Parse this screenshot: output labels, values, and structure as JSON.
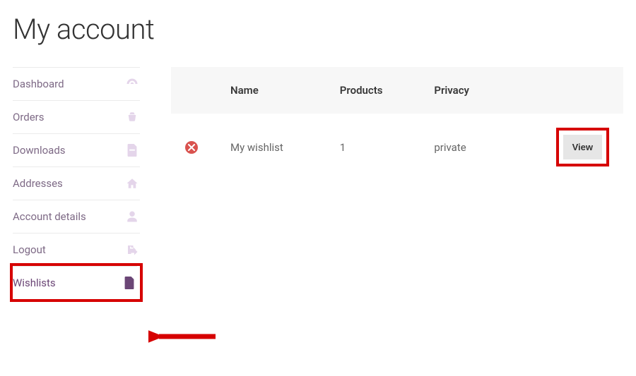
{
  "title": "My account",
  "sidebar": {
    "items": [
      {
        "label": "Dashboard",
        "icon": "dashboard-icon"
      },
      {
        "label": "Orders",
        "icon": "basket-icon"
      },
      {
        "label": "Downloads",
        "icon": "file-icon"
      },
      {
        "label": "Addresses",
        "icon": "home-icon"
      },
      {
        "label": "Account details",
        "icon": "user-icon"
      },
      {
        "label": "Logout",
        "icon": "logout-icon"
      },
      {
        "label": "Wishlists",
        "icon": "document-icon"
      }
    ]
  },
  "table": {
    "headers": {
      "name": "Name",
      "products": "Products",
      "privacy": "Privacy"
    },
    "rows": [
      {
        "name": "My wishlist",
        "products": "1",
        "privacy": "private",
        "action": "View"
      }
    ]
  }
}
